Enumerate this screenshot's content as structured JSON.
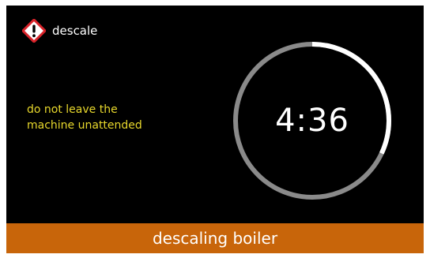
{
  "header": {
    "title": "descale",
    "icon": "warning-diamond-icon"
  },
  "notice": {
    "text": "do not leave the\nmachine unattended"
  },
  "timer": {
    "remaining": "4:36",
    "progress": 0.32
  },
  "status_bar": {
    "text": "descaling boiler"
  },
  "colors": {
    "background": "#000000",
    "notice_text": "#e8d82c",
    "status_bar": "#c8650a",
    "ring_track": "#8a8a8a",
    "ring_progress": "#ffffff",
    "warning_red": "#d8232a"
  }
}
